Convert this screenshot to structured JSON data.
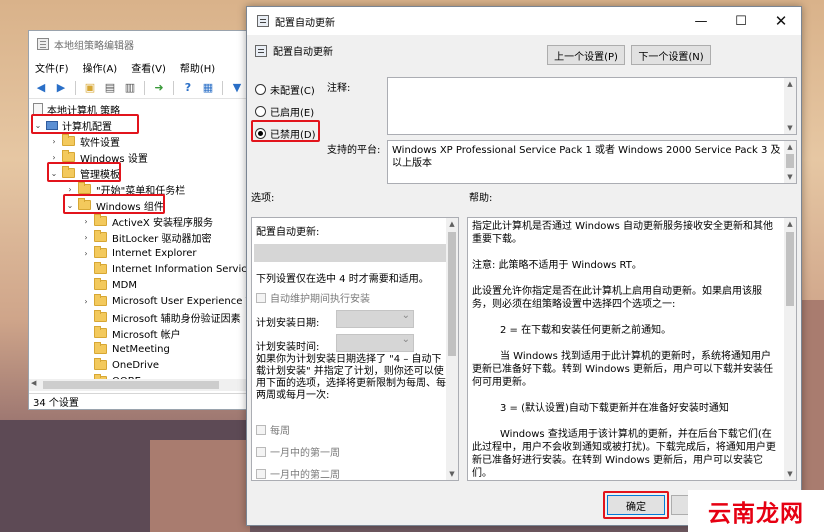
{
  "gpedit": {
    "title": "本地组策略编辑器",
    "menu": [
      "文件(F)",
      "操作(A)",
      "查看(V)",
      "帮助(H)"
    ],
    "tree": {
      "root": "本地计算机 策略",
      "computer_config": "计算机配置",
      "software_settings": "软件设置",
      "windows_settings": "Windows 设置",
      "admin_templates": "管理模板",
      "start_menu": "\"开始\"菜单和任务栏",
      "windows_components": "Windows 组件",
      "children": [
        "ActiveX 安装程序服务",
        "BitLocker 驱动器加密",
        "Internet Explorer",
        "Internet Information Services",
        "MDM",
        "Microsoft User Experience Vi",
        "Microsoft 辅助身份验证因素",
        "Microsoft 帐户",
        "NetMeeting",
        "OneDrive",
        "OOBE"
      ]
    },
    "status": "34 个设置"
  },
  "dialog": {
    "title": "配置自动更新",
    "policy_name": "配置自动更新",
    "prev_button": "上一个设置(P)",
    "next_button": "下一个设置(N)",
    "radio": [
      {
        "label": "未配置(C)",
        "checked": false
      },
      {
        "label": "已启用(E)",
        "checked": false
      },
      {
        "label": "已禁用(D)",
        "checked": true
      }
    ],
    "comment_label": "注释:",
    "platform_label": "支持的平台:",
    "platform_text": "Windows XP Professional Service Pack 1 或者 Windows 2000 Service Pack 3 及以上版本",
    "options_label": "选项:",
    "help_label": "帮助:",
    "options": {
      "heading": "配置自动更新:",
      "note": "下列设置仅在选中 4 时才需要和适用。",
      "auto_maintenance": "自动维护期间执行安装",
      "install_date": "计划安装日期:",
      "install_time": "计划安装时间:",
      "long_text": "如果你为计划安装日期选择了 \"4 – 自动下载计划安装\" 并指定了计划，则你还可以使用下面的选项，选择将更新限制为每周、每两周或每月一次:",
      "every_week": "每周",
      "first_week": "一月中的第一周",
      "second_week": "一月中的第二周"
    },
    "help": [
      "指定此计算机是否通过 Windows 自动更新服务接收安全更新和其他重要下载。",
      "注意: 此策略不适用于 Windows RT。",
      "此设置允许你指定是否在此计算机上启用自动更新。如果启用该服务，则必须在组策略设置中选择四个选项之一:",
      "2 = 在下载和安装任何更新之前通知。",
      "当 Windows 找到适用于此计算机的更新时，系统将通知用户更新已准备好下载。转到 Windows 更新后，用户可以下载并安装任何可用更新。",
      "3 = (默认设置)自动下载更新并在准备好安装时通知",
      "Windows 查找适用于该计算机的更新，并在后台下载它们(在此过程中，用户不会收到通知或被打扰)。下载完成后，将通知用户更新已准备好进行安装。在转到 Windows 更新后，用户可以安装它们。"
    ],
    "ok_button": "确定"
  },
  "watermark": "云南龙网"
}
